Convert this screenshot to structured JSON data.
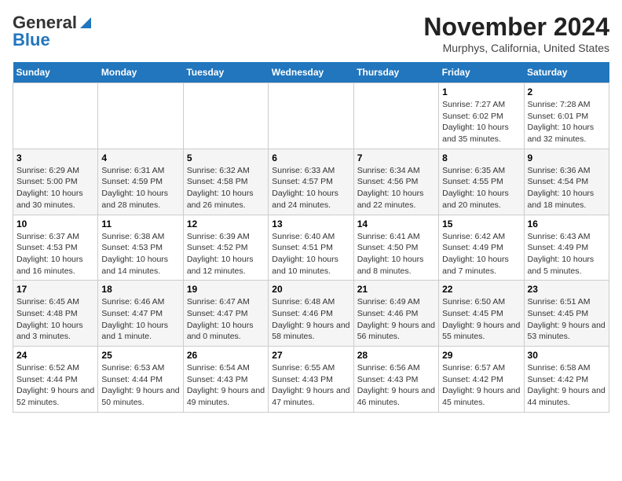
{
  "app": {
    "name_general": "General",
    "name_blue": "Blue",
    "month_title": "November 2024",
    "location": "Murphys, California, United States"
  },
  "calendar": {
    "headers": [
      "Sunday",
      "Monday",
      "Tuesday",
      "Wednesday",
      "Thursday",
      "Friday",
      "Saturday"
    ],
    "weeks": [
      [
        {
          "day": "",
          "info": ""
        },
        {
          "day": "",
          "info": ""
        },
        {
          "day": "",
          "info": ""
        },
        {
          "day": "",
          "info": ""
        },
        {
          "day": "",
          "info": ""
        },
        {
          "day": "1",
          "info": "Sunrise: 7:27 AM\nSunset: 6:02 PM\nDaylight: 10 hours and 35 minutes."
        },
        {
          "day": "2",
          "info": "Sunrise: 7:28 AM\nSunset: 6:01 PM\nDaylight: 10 hours and 32 minutes."
        }
      ],
      [
        {
          "day": "3",
          "info": "Sunrise: 6:29 AM\nSunset: 5:00 PM\nDaylight: 10 hours and 30 minutes."
        },
        {
          "day": "4",
          "info": "Sunrise: 6:31 AM\nSunset: 4:59 PM\nDaylight: 10 hours and 28 minutes."
        },
        {
          "day": "5",
          "info": "Sunrise: 6:32 AM\nSunset: 4:58 PM\nDaylight: 10 hours and 26 minutes."
        },
        {
          "day": "6",
          "info": "Sunrise: 6:33 AM\nSunset: 4:57 PM\nDaylight: 10 hours and 24 minutes."
        },
        {
          "day": "7",
          "info": "Sunrise: 6:34 AM\nSunset: 4:56 PM\nDaylight: 10 hours and 22 minutes."
        },
        {
          "day": "8",
          "info": "Sunrise: 6:35 AM\nSunset: 4:55 PM\nDaylight: 10 hours and 20 minutes."
        },
        {
          "day": "9",
          "info": "Sunrise: 6:36 AM\nSunset: 4:54 PM\nDaylight: 10 hours and 18 minutes."
        }
      ],
      [
        {
          "day": "10",
          "info": "Sunrise: 6:37 AM\nSunset: 4:53 PM\nDaylight: 10 hours and 16 minutes."
        },
        {
          "day": "11",
          "info": "Sunrise: 6:38 AM\nSunset: 4:53 PM\nDaylight: 10 hours and 14 minutes."
        },
        {
          "day": "12",
          "info": "Sunrise: 6:39 AM\nSunset: 4:52 PM\nDaylight: 10 hours and 12 minutes."
        },
        {
          "day": "13",
          "info": "Sunrise: 6:40 AM\nSunset: 4:51 PM\nDaylight: 10 hours and 10 minutes."
        },
        {
          "day": "14",
          "info": "Sunrise: 6:41 AM\nSunset: 4:50 PM\nDaylight: 10 hours and 8 minutes."
        },
        {
          "day": "15",
          "info": "Sunrise: 6:42 AM\nSunset: 4:49 PM\nDaylight: 10 hours and 7 minutes."
        },
        {
          "day": "16",
          "info": "Sunrise: 6:43 AM\nSunset: 4:49 PM\nDaylight: 10 hours and 5 minutes."
        }
      ],
      [
        {
          "day": "17",
          "info": "Sunrise: 6:45 AM\nSunset: 4:48 PM\nDaylight: 10 hours and 3 minutes."
        },
        {
          "day": "18",
          "info": "Sunrise: 6:46 AM\nSunset: 4:47 PM\nDaylight: 10 hours and 1 minute."
        },
        {
          "day": "19",
          "info": "Sunrise: 6:47 AM\nSunset: 4:47 PM\nDaylight: 10 hours and 0 minutes."
        },
        {
          "day": "20",
          "info": "Sunrise: 6:48 AM\nSunset: 4:46 PM\nDaylight: 9 hours and 58 minutes."
        },
        {
          "day": "21",
          "info": "Sunrise: 6:49 AM\nSunset: 4:46 PM\nDaylight: 9 hours and 56 minutes."
        },
        {
          "day": "22",
          "info": "Sunrise: 6:50 AM\nSunset: 4:45 PM\nDaylight: 9 hours and 55 minutes."
        },
        {
          "day": "23",
          "info": "Sunrise: 6:51 AM\nSunset: 4:45 PM\nDaylight: 9 hours and 53 minutes."
        }
      ],
      [
        {
          "day": "24",
          "info": "Sunrise: 6:52 AM\nSunset: 4:44 PM\nDaylight: 9 hours and 52 minutes."
        },
        {
          "day": "25",
          "info": "Sunrise: 6:53 AM\nSunset: 4:44 PM\nDaylight: 9 hours and 50 minutes."
        },
        {
          "day": "26",
          "info": "Sunrise: 6:54 AM\nSunset: 4:43 PM\nDaylight: 9 hours and 49 minutes."
        },
        {
          "day": "27",
          "info": "Sunrise: 6:55 AM\nSunset: 4:43 PM\nDaylight: 9 hours and 47 minutes."
        },
        {
          "day": "28",
          "info": "Sunrise: 6:56 AM\nSunset: 4:43 PM\nDaylight: 9 hours and 46 minutes."
        },
        {
          "day": "29",
          "info": "Sunrise: 6:57 AM\nSunset: 4:42 PM\nDaylight: 9 hours and 45 minutes."
        },
        {
          "day": "30",
          "info": "Sunrise: 6:58 AM\nSunset: 4:42 PM\nDaylight: 9 hours and 44 minutes."
        }
      ]
    ]
  }
}
